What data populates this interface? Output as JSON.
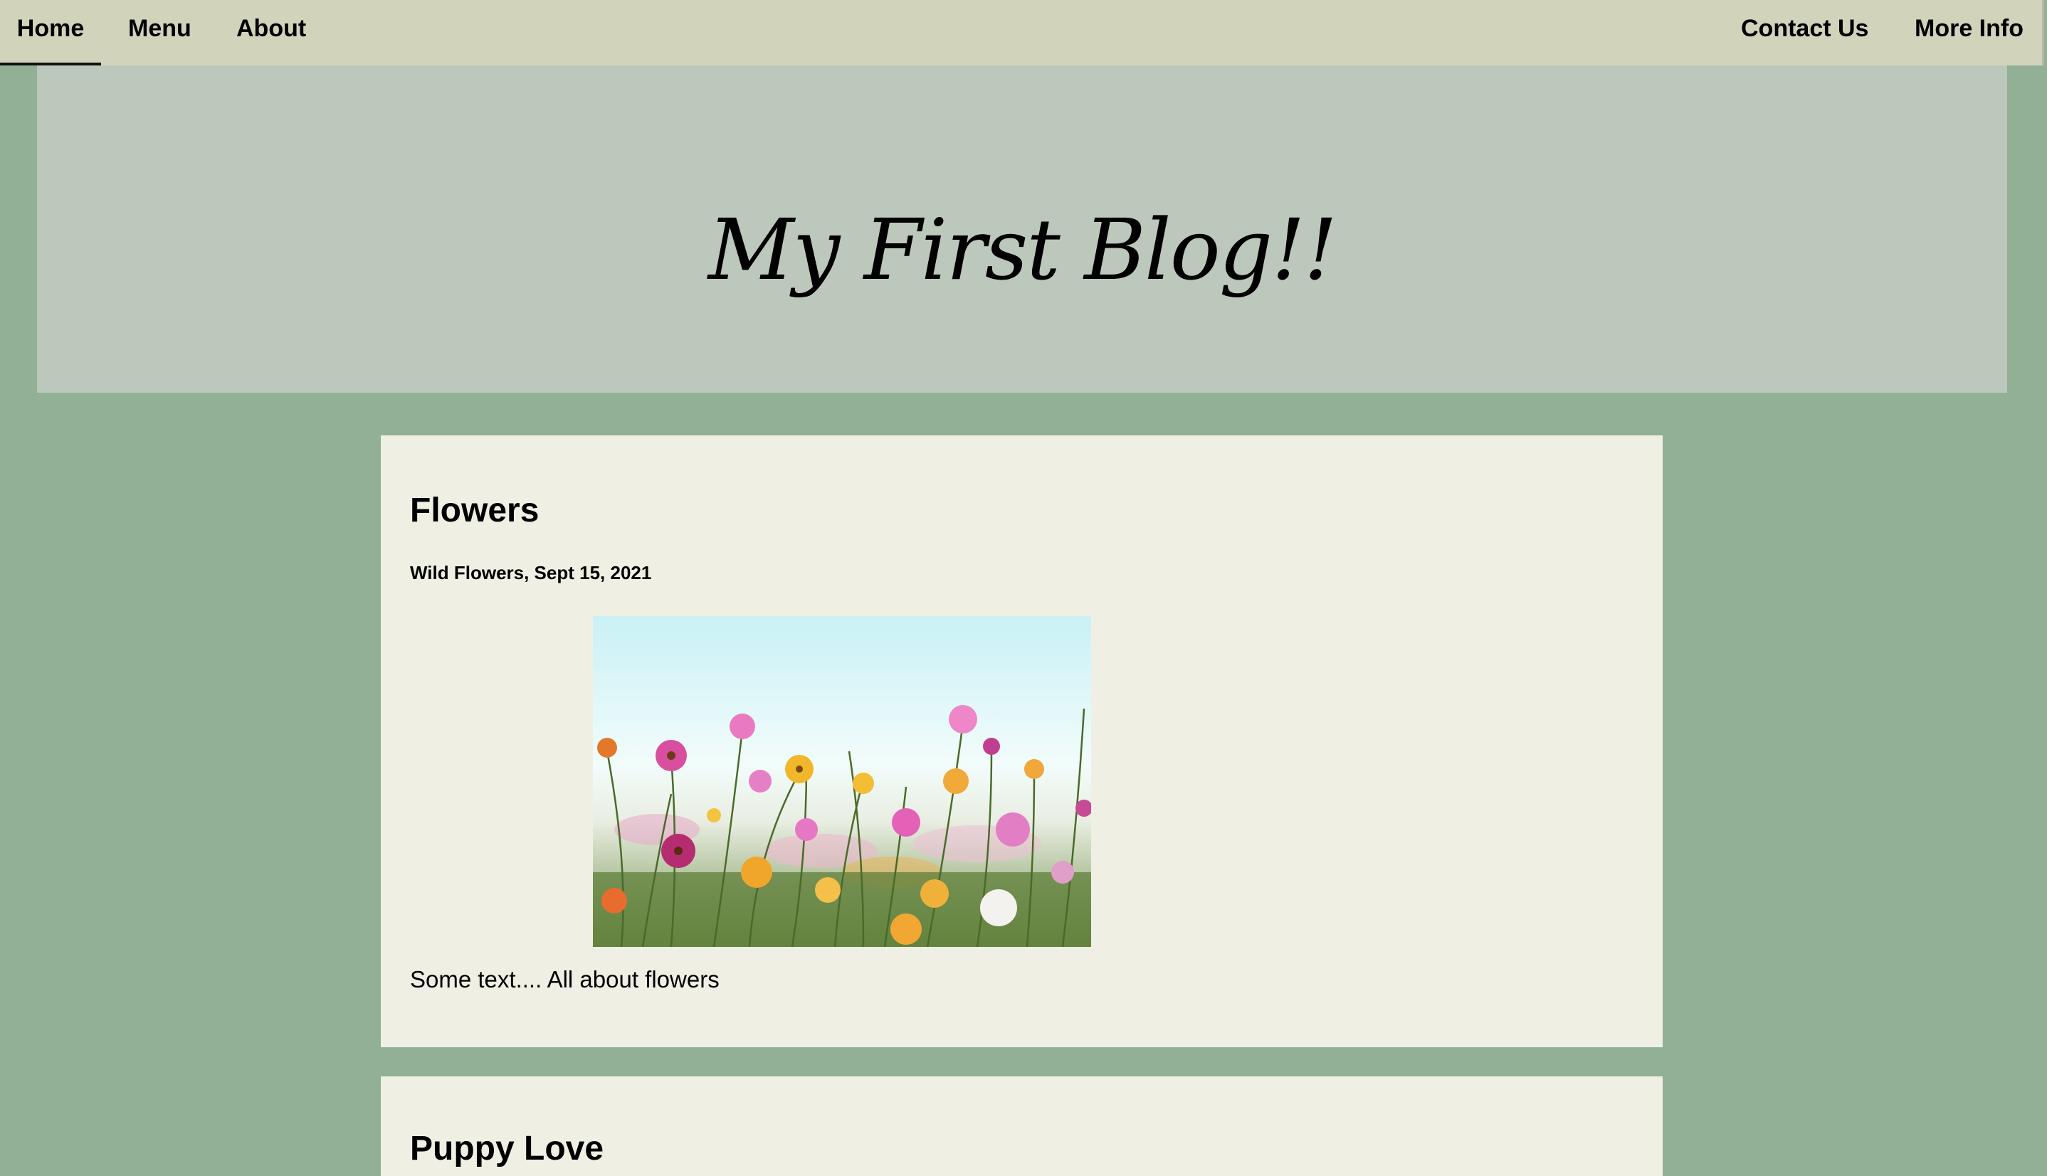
{
  "nav": {
    "home": "Home",
    "menu": "Menu",
    "about": "About",
    "contact": "Contact Us",
    "more": "More Info"
  },
  "header": {
    "title": "My First Blog!!"
  },
  "posts": [
    {
      "title": "Flowers",
      "meta": "Wild Flowers, Sept 15, 2021",
      "text": "Some text.... All about flowers"
    },
    {
      "title": "Puppy Love"
    }
  ],
  "colors": {
    "page_bg": "#91b095",
    "nav_bg": "#d1d4bb",
    "header_bg": "#bcc8bb",
    "card_bg": "#eff0e3"
  }
}
